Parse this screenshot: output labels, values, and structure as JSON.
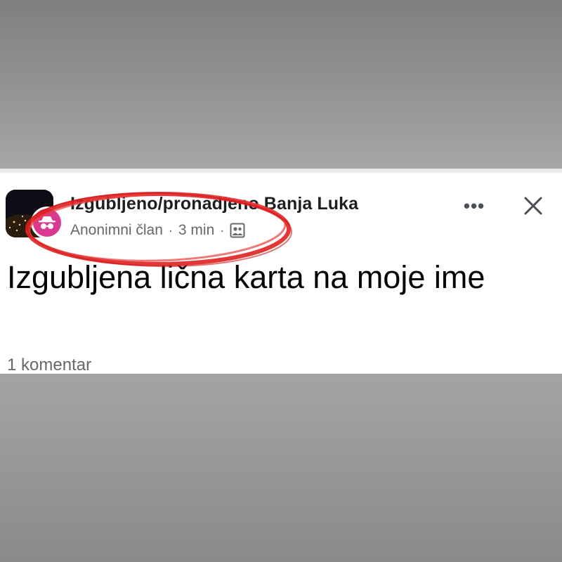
{
  "post": {
    "group_name": "Izgubljeno/pronadjeno Banja Luka",
    "author": "Anonimni član",
    "separator": "·",
    "time": "3 min",
    "text": "Izgubljena lična karta na moje ime",
    "comments": "1 komentar"
  },
  "actions": {
    "more_label": "•••"
  },
  "colors": {
    "card_bg": "#ffffff",
    "anon_avatar": "#d9398f",
    "highlight": "#e02020",
    "meta_text": "#65676b"
  },
  "icons": {
    "group_avatar": "city-night-photo",
    "anon_avatar": "incognito-icon",
    "audience": "group-audience-icon",
    "more": "more-dots-icon",
    "close": "close-icon"
  }
}
